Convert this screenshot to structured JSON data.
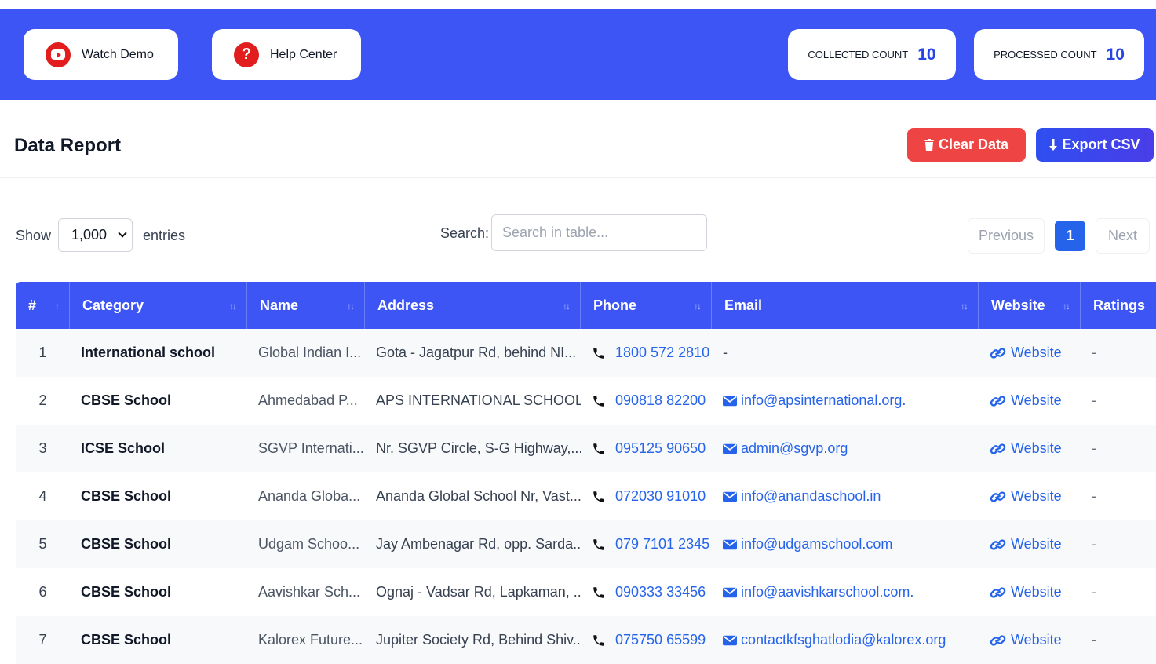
{
  "toolbar": {
    "watch_demo": "Watch Demo",
    "help_center": "Help Center",
    "collected_label": "COLLECTED COUNT",
    "collected_value": "10",
    "processed_label": "PROCESSED COUNT",
    "processed_value": "10"
  },
  "report": {
    "title": "Data Report",
    "clear_label": "Clear Data",
    "export_label": "Export CSV"
  },
  "controls": {
    "show_label": "Show",
    "entries_value": "1,000",
    "entries_label": "entries",
    "search_label": "Search:",
    "search_placeholder": "Search in table...",
    "previous": "Previous",
    "current_page": "1",
    "next": "Next"
  },
  "table": {
    "headers": [
      "#",
      "Category",
      "Name",
      "Address",
      "Phone",
      "Email",
      "Website",
      "Ratings"
    ],
    "rows": [
      {
        "num": "1",
        "category": "International school",
        "name": "Global Indian I...",
        "address": "Gota - Jagatpur Rd, behind NI...",
        "phone": "1800 572 2810",
        "email": "-",
        "website": "Website",
        "ratings": "-"
      },
      {
        "num": "2",
        "category": "CBSE School",
        "name": "Ahmedabad P...",
        "address": "APS INTERNATIONAL SCHOOL...",
        "phone": "090818 82200",
        "email": "info@apsinternational.org.",
        "website": "Website",
        "ratings": "-"
      },
      {
        "num": "3",
        "category": "ICSE School",
        "name": "SGVP Internati...",
        "address": "Nr. SGVP Circle, S-G Highway,...",
        "phone": "095125 90650",
        "email": "admin@sgvp.org",
        "website": "Website",
        "ratings": "-"
      },
      {
        "num": "4",
        "category": "CBSE School",
        "name": "Ananda Globa...",
        "address": "Ananda Global School Nr, Vast...",
        "phone": "072030 91010",
        "email": "info@anandaschool.in",
        "website": "Website",
        "ratings": "-"
      },
      {
        "num": "5",
        "category": "CBSE School",
        "name": "Udgam Schoo...",
        "address": "Jay Ambenagar Rd, opp. Sarda...",
        "phone": "079 7101 2345",
        "email": "info@udgamschool.com",
        "website": "Website",
        "ratings": "-"
      },
      {
        "num": "6",
        "category": "CBSE School",
        "name": "Aavishkar Sch...",
        "address": "Ognaj - Vadsar Rd, Lapkaman, ...",
        "phone": "090333 33456",
        "email": "info@aavishkarschool.com.",
        "website": "Website",
        "ratings": "-"
      },
      {
        "num": "7",
        "category": "CBSE School",
        "name": "Kalorex Future...",
        "address": "Jupiter Society Rd, Behind Shiv...",
        "phone": "075750 65599",
        "email": "contactkfsghatlodia@kalorex.org",
        "website": "Website",
        "ratings": "-"
      }
    ]
  },
  "colors": {
    "banner": "#3d55f5",
    "accent": "#2563eb",
    "danger": "#ef4444"
  },
  "icons": [
    "youtube-icon",
    "help-icon",
    "trash-icon",
    "download-icon",
    "phone-icon",
    "mail-icon",
    "link-icon",
    "sort-icon",
    "chevron-down-icon"
  ]
}
